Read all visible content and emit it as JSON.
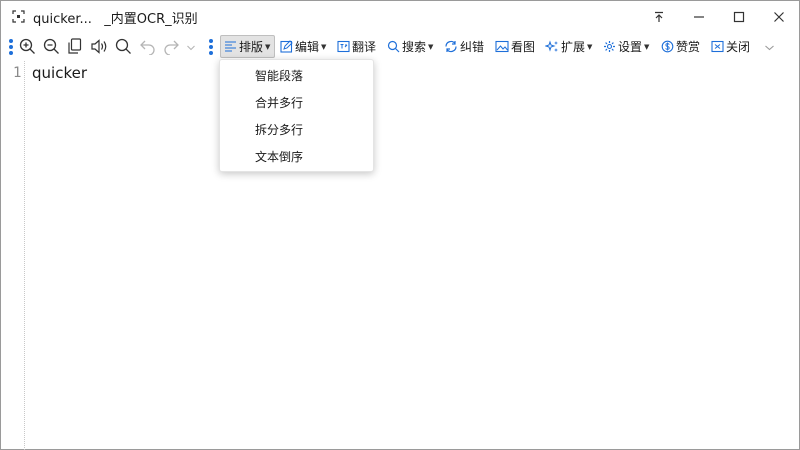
{
  "window": {
    "title_part1": "quicker...",
    "title_part2": "_内置OCR_识别"
  },
  "toolbar": {
    "layout_label": "排版",
    "edit_label": "编辑",
    "translate_label": "翻译",
    "search_label": "搜索",
    "correct_label": "纠错",
    "view_image_label": "看图",
    "extend_label": "扩展",
    "settings_label": "设置",
    "donate_label": "赞赏",
    "close_label": "关闭"
  },
  "editor": {
    "lines": [
      {
        "number": "1",
        "text": "quicker"
      }
    ]
  },
  "layout_menu": {
    "items": [
      {
        "label": "智能段落"
      },
      {
        "label": "合并多行"
      },
      {
        "label": "拆分多行"
      },
      {
        "label": "文本倒序"
      }
    ]
  },
  "colors": {
    "accent_blue": "#1e6fd9",
    "toolbar_icon": "#333333",
    "disabled_icon": "#b5b5b5"
  }
}
